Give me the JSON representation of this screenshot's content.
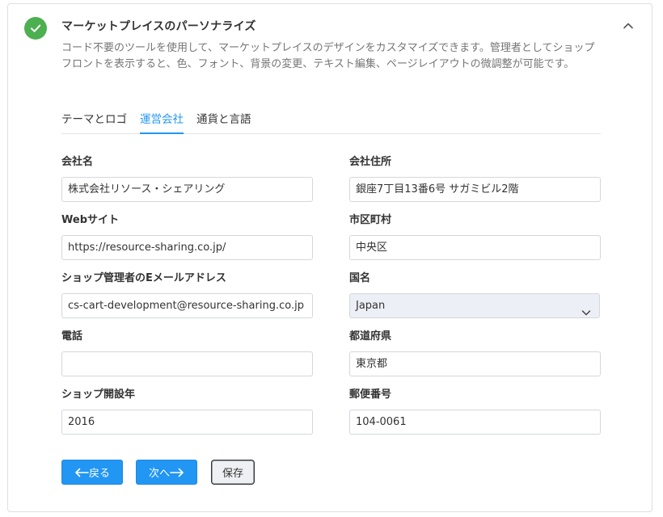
{
  "header": {
    "title": "マーケットプレイスのパーソナライズ",
    "description": "コード不要のツールを使用して、マーケットプレイスのデザインをカスタマイズできます。管理者としてショップフロントを表示すると、色、フォント、背景の変更、テキスト編集、ページレイアウトの微調整が可能です。"
  },
  "tabs": [
    {
      "label": "テーマとロゴ",
      "active": false
    },
    {
      "label": "運営会社",
      "active": true
    },
    {
      "label": "通貨と言語",
      "active": false
    }
  ],
  "form": {
    "company_name": {
      "label": "会社名",
      "value": "株式会社リソース・シェアリング"
    },
    "company_address": {
      "label": "会社住所",
      "value": "銀座7丁目13番6号 サガミビル2階"
    },
    "website": {
      "label": "Webサイト",
      "value": "https://resource-sharing.co.jp/"
    },
    "city": {
      "label": "市区町村",
      "value": "中央区"
    },
    "admin_email": {
      "label": "ショップ管理者のEメールアドレス",
      "value": "cs-cart-development@resource-sharing.co.jp"
    },
    "country": {
      "label": "国名",
      "value": "Japan"
    },
    "phone": {
      "label": "電話",
      "value": ""
    },
    "state": {
      "label": "都道府県",
      "value": "東京都"
    },
    "founded_year": {
      "label": "ショップ開設年",
      "value": "2016"
    },
    "zip": {
      "label": "郵便番号",
      "value": "104-0061"
    }
  },
  "buttons": {
    "back": "戻る",
    "next": "次へ",
    "save": "保存"
  },
  "colors": {
    "accent": "#2196f3",
    "success": "#4caf50"
  },
  "icons": {
    "status": "check-circle-icon",
    "collapse": "chevron-up-icon",
    "select": "chevron-down-icon",
    "back": "arrow-left-icon",
    "next": "arrow-right-icon"
  }
}
